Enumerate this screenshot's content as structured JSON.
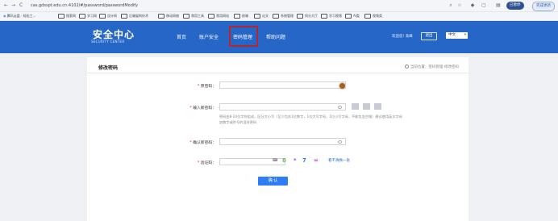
{
  "browser": {
    "back": "←",
    "forward": "→",
    "reload": "C",
    "url": "cas.gdsspt.edu.cn:4102/#/password/passwordModify",
    "profile_label": "已暂停",
    "sync_label": "完成更新",
    "bookmarks": [
      {
        "label": "腾讯云盘 · 轻松工..."
      },
      {
        "label": "搜索网"
      },
      {
        "label": "学习网"
      },
      {
        "label": "设计网"
      },
      {
        "label": "后端架构技术"
      },
      {
        "label": "移动网络"
      },
      {
        "label": "常用工具"
      },
      {
        "label": "常用网站"
      },
      {
        "label": "前端"
      },
      {
        "label": "论文"
      },
      {
        "label": "系统管理"
      },
      {
        "label": "同分大厅"
      },
      {
        "label": "学习视频"
      },
      {
        "label": "AI类"
      },
      {
        "label": "视频类"
      }
    ]
  },
  "header": {
    "logo_main": "安全中心",
    "logo_sub": "SECURITY CENTER",
    "menu": [
      {
        "label": "首页"
      },
      {
        "label": "账户安全"
      },
      {
        "label": "密码管理"
      },
      {
        "label": "帮助问题"
      }
    ],
    "welcome": "欢迎您! 高峰",
    "logout": "退出",
    "language": "中文",
    "lang_arrow": "▾"
  },
  "main": {
    "title": "修改密码",
    "breadcrumb": "当前位置：密码管理-修改密码",
    "form": {
      "old_password_label": "原密码：",
      "new_password_label": "输入新密码：",
      "new_password_hint": "密码由8-24位字符组成，区分大小写（至少包含1位数字，1位大写字母，1位小写字母，不能包含空格）建议使用英文字母加数字或符号的混合密码",
      "confirm_password_label": "确认新密码：",
      "captcha_label": "验证码：",
      "captcha_chars": [
        {
          "text": "8",
          "color": "#6bb85a"
        },
        {
          "text": "*",
          "color": "#8a5bc8"
        },
        {
          "text": "7",
          "color": "#2d7fd6"
        },
        {
          "text": "=",
          "color": "#c64ad0"
        }
      ],
      "captcha_refresh": "看不清换一张",
      "submit": "确 认",
      "required_mark": "*"
    }
  }
}
